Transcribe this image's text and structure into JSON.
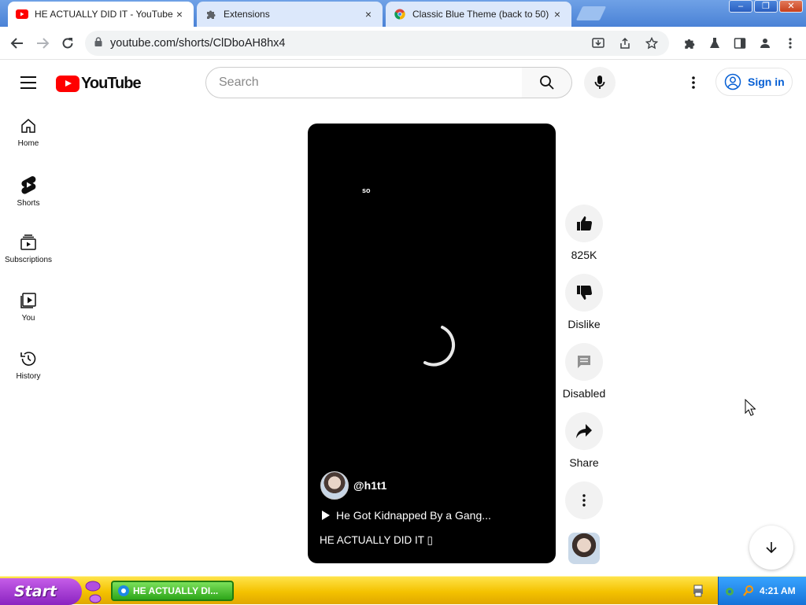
{
  "tabs": [
    {
      "title": "HE ACTUALLY DID IT  - YouTube",
      "favicon": "youtube-icon",
      "close": "×"
    },
    {
      "title": "Extensions",
      "favicon": "puzzle-icon",
      "close": "×"
    },
    {
      "title": "Classic Blue Theme (back to 50)",
      "favicon": "chrome-icon",
      "close": "×"
    }
  ],
  "window_buttons": {
    "minimize": "–",
    "restore": "❐",
    "close": "✕"
  },
  "omnibox": {
    "url": "youtube.com/shorts/ClDboAH8hx4"
  },
  "youtube": {
    "logo_text": "YouTube",
    "search_placeholder": "Search",
    "sign_in": "Sign in",
    "guide": [
      {
        "label": "Home",
        "icon": "home-icon"
      },
      {
        "label": "Shorts",
        "icon": "shorts-icon"
      },
      {
        "label": "Subscriptions",
        "icon": "subscriptions-icon"
      },
      {
        "label": "You",
        "icon": "you-icon"
      },
      {
        "label": "History",
        "icon": "history-icon"
      }
    ]
  },
  "short": {
    "caption": "so",
    "channel_handle": "@h1t1",
    "music_title": "He Got Kidnapped By a Gang...",
    "title": "HE ACTUALLY DID IT ▯"
  },
  "actions": {
    "like_count": "825K",
    "dislike_label": "Dislike",
    "comments_label": "Disabled",
    "share_label": "Share"
  },
  "taskbar": {
    "start_label": "Start",
    "task_label": "HE ACTUALLY DI...",
    "clock": "4:21 AM"
  },
  "colors": {
    "brand_red": "#ff0000",
    "link_blue": "#065fd4",
    "taskbar_yellow": "#f4c200",
    "start_purple": "#8a23c0"
  }
}
